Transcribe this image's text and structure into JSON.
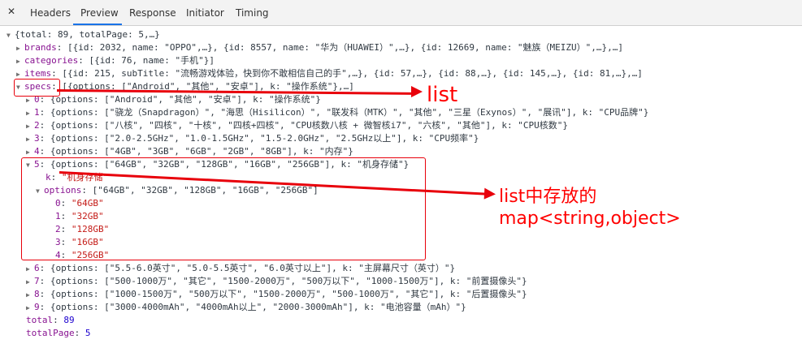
{
  "tabs": {
    "close_icon": "✕",
    "items": [
      "Headers",
      "Preview",
      "Response",
      "Initiator",
      "Timing"
    ],
    "active": "Preview"
  },
  "preview": {
    "root": "{total: 89, totalPage: 5,…}",
    "brands_key": "brands",
    "brands_val": "[{id: 2032, name: \"OPPO\",…}, {id: 8557, name: \"华为（HUAWEI）\",…}, {id: 12669, name: \"魅族（MEIZU）\",…},…]",
    "categories_key": "categories",
    "categories_val": "[{id: 76, name: \"手机\"}]",
    "items_key": "items",
    "items_val": "[{id: 215, subTitle: \"流畅游戏体验，快到你不敢相信自己的手\",…}, {id: 57,…}, {id: 88,…}, {id: 145,…}, {id: 81,…},…]",
    "specs_key": "specs",
    "specs_val": "[{options: [\"Android\", \"其他\", \"安卓\"], k: \"操作系统\"},…]",
    "spec_rows": [
      {
        "idx": "0",
        "val": "{options: [\"Android\", \"其他\", \"安卓\"], k: \"操作系统\"}"
      },
      {
        "idx": "1",
        "val": "{options: [\"骁龙（Snapdragon）\", \"海思（Hisilicon）\", \"联发科（MTK）\", \"其他\", \"三星（Exynos）\", \"展讯\"], k: \"CPU品牌\"}"
      },
      {
        "idx": "2",
        "val": "{options: [\"八核\", \"四核\", \"十核\", \"四核+四核\", \"CPU核数八核 + 微智核i7\", \"六核\", \"其他\"], k: \"CPU核数\"}"
      },
      {
        "idx": "3",
        "val": "{options: [\"2.0-2.5GHz\", \"1.0-1.5GHz\", \"1.5-2.0GHz\", \"2.5GHz以上\"], k: \"CPU频率\"}"
      },
      {
        "idx": "4",
        "val": "{options: [\"4GB\", \"3GB\", \"6GB\", \"2GB\", \"8GB\"], k: \"内存\"}"
      },
      {
        "idx": "5",
        "val": "{options: [\"64GB\", \"32GB\", \"128GB\", \"16GB\", \"256GB\"], k: \"机身存储\"}"
      },
      {
        "idx": "6",
        "val": "{options: [\"5.5-6.0英寸\", \"5.0-5.5英寸\", \"6.0英寸以上\"], k: \"主屏幕尺寸（英寸）\"}"
      },
      {
        "idx": "7",
        "val": "{options: [\"500-1000万\", \"其它\", \"1500-2000万\", \"500万以下\", \"1000-1500万\"], k: \"前置摄像头\"}"
      },
      {
        "idx": "8",
        "val": "{options: [\"1000-1500万\", \"500万以下\", \"1500-2000万\", \"500-1000万\", \"其它\"], k: \"后置摄像头\"}"
      },
      {
        "idx": "9",
        "val": "{options: [\"3000-4000mAh\", \"4000mAh以上\", \"2000-3000mAh\"], k: \"电池容量（mAh）\"}"
      }
    ],
    "expanded": {
      "k_key": "k",
      "k_val": "\"机身存储\"",
      "options_key": "options",
      "options_val": "[\"64GB\", \"32GB\", \"128GB\", \"16GB\", \"256GB\"]",
      "opts": [
        {
          "idx": "0",
          "val": "\"64GB\""
        },
        {
          "idx": "1",
          "val": "\"32GB\""
        },
        {
          "idx": "2",
          "val": "\"128GB\""
        },
        {
          "idx": "3",
          "val": "\"16GB\""
        },
        {
          "idx": "4",
          "val": "\"256GB\""
        }
      ]
    },
    "total_key": "total",
    "total_val": "89",
    "totalPage_key": "totalPage",
    "totalPage_val": "5"
  },
  "annotations": {
    "list": "list",
    "map_line1": "list中存放的",
    "map_line2": "map<string,object>",
    "color": "#ff0000"
  }
}
